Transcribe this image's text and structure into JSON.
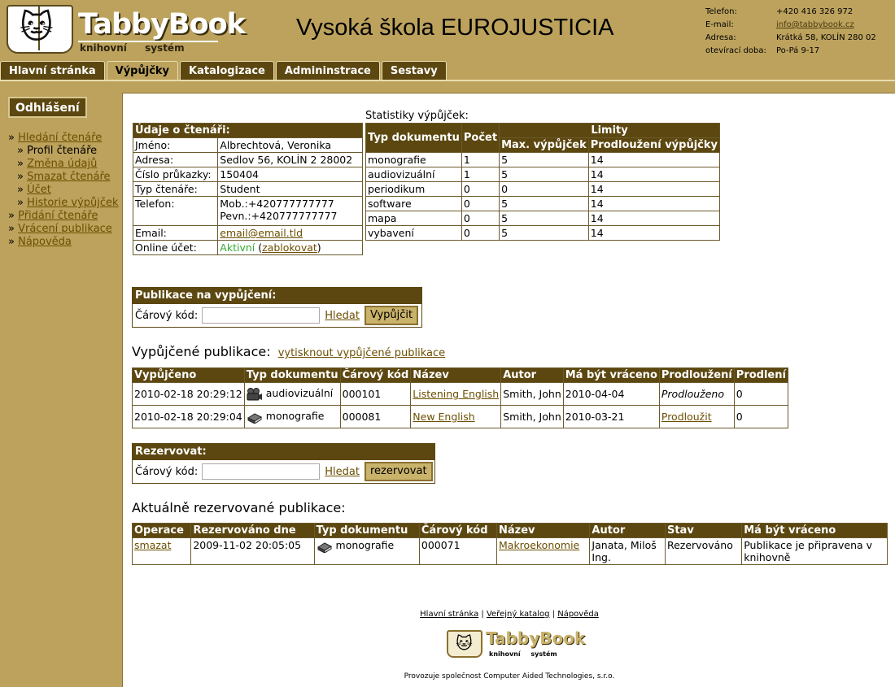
{
  "header": {
    "logo_name": "TabbyBook",
    "logo_sub": "knihovní systém",
    "school": "Vysoká škola EUROJUSTICIA",
    "contact": [
      {
        "k": "Telefon:",
        "v": "+420 416 326 972"
      },
      {
        "k": "E-mail:",
        "v": "info@tabbybook.cz"
      },
      {
        "k": "Adresa:",
        "v": "Krátká 58, KOLÍN 280 02"
      },
      {
        "k": "otevírací doba:",
        "v": "Po-Pá 9-17"
      }
    ]
  },
  "tabs": [
    "Hlavní stránka",
    "Výpůjčky",
    "Katalogizace",
    "Admininstrace",
    "Sestavy"
  ],
  "sidebar": {
    "logout": "Odhlášení",
    "items": [
      {
        "label": "Hledání čtenáře",
        "link": true,
        "sub": false
      },
      {
        "label": "Profil čtenáře",
        "link": false,
        "sub": true
      },
      {
        "label": "Změna údajů",
        "link": true,
        "sub": true
      },
      {
        "label": "Smazat čtenáře",
        "link": true,
        "sub": true
      },
      {
        "label": "Účet",
        "link": true,
        "sub": true
      },
      {
        "label": "Historie výpůjček",
        "link": true,
        "sub": true
      },
      {
        "label": "Přidání čtenáře",
        "link": true,
        "sub": false
      },
      {
        "label": "Vrácení publikace",
        "link": true,
        "sub": false
      },
      {
        "label": "Nápověda",
        "link": true,
        "sub": false
      }
    ]
  },
  "reader": {
    "title": "Údaje o čtenáři:",
    "name_label": "Jméno:",
    "name": "Albrechtová, Veronika",
    "address_label": "Adresa:",
    "address": "Sedlov 56, KOLÍN 2 28002",
    "card_label": "Číslo průkazky:",
    "card": "150404",
    "type_label": "Typ čtenáře:",
    "type": "Student",
    "phone_label": "Telefon:",
    "phone_mob": "Mob.:+420777777777",
    "phone_fix": "Pevn.:+420777777777",
    "email_label": "Email:",
    "email": "email@email.tld",
    "online_label": "Online účet:",
    "online_status": "Aktivní",
    "online_action": "zablokovat"
  },
  "stats": {
    "title": "Statistiky výpůjček:",
    "col_type": "Typ dokumentu",
    "col_count": "Počet",
    "col_limits": "Limity",
    "col_max": "Max. výpůjček",
    "col_ext": "Prodloužení výpůjčky",
    "rows": [
      [
        "monografie",
        "1",
        "5",
        "14"
      ],
      [
        "audiovizuální",
        "1",
        "5",
        "14"
      ],
      [
        "periodikum",
        "0",
        "0",
        "14"
      ],
      [
        "software",
        "0",
        "5",
        "14"
      ],
      [
        "mapa",
        "0",
        "5",
        "14"
      ],
      [
        "vybavení",
        "0",
        "5",
        "14"
      ]
    ]
  },
  "lend": {
    "title": "Publikace na vypůjčení:",
    "barcode_label": "Čárový kód:",
    "search": "Hledat",
    "submit": "Vypůjčit"
  },
  "loans": {
    "title": "Vypůjčené publikace:",
    "print": "vytisknout vypůjčené publikace",
    "headers": [
      "Vypůjčeno",
      "Typ dokumentu",
      "Čárový kód",
      "Název",
      "Autor",
      "Má být vráceno",
      "Prodloužení",
      "Prodlení"
    ],
    "rows": [
      {
        "date": "2010-02-18 20:29:12",
        "icon": "video-camera-icon",
        "type": "audiovizuální",
        "code": "000101",
        "title": "Listening English",
        "author": "Smith, John",
        "due": "2010-04-04",
        "ext": "Prodlouženo",
        "ext_link": false,
        "late": "0"
      },
      {
        "date": "2010-02-18 20:29:04",
        "icon": "book-icon",
        "type": "monografie",
        "code": "000081",
        "title": "New English",
        "author": "Smith, John",
        "due": "2010-03-21",
        "ext": "Prodloužit",
        "ext_link": true,
        "late": "0"
      }
    ]
  },
  "reserve": {
    "title": "Rezervovat:",
    "barcode_label": "Čárový kód:",
    "search": "Hledat",
    "submit": "rezervovat"
  },
  "reservations": {
    "title": "Aktuálně rezervované publikace:",
    "headers": [
      "Operace",
      "Rezervováno dne",
      "Typ dokumentu",
      "Čárový kód",
      "Název",
      "Autor",
      "Stav",
      "Má být vráceno"
    ],
    "rows": [
      {
        "op": "smazat",
        "date": "2009-11-02 20:05:05",
        "icon": "book-icon",
        "type": "monografie",
        "code": "000071",
        "title": "Makroekonomie",
        "author_1": "Janata, Miloš",
        "author_2": "Ing.",
        "state": "Rezervováno",
        "due_1": "Publikace je připravena v",
        "due_2": "knihovně"
      }
    ]
  },
  "footer": {
    "links": [
      "Hlavní stránka",
      "Veřejný katalog",
      "Nápověda"
    ],
    "logo_name": "TabbyBook",
    "logo_sub": "knihovní systém",
    "operator": "Provozuje společnost Computer Aided Technologies, s.r.o."
  }
}
